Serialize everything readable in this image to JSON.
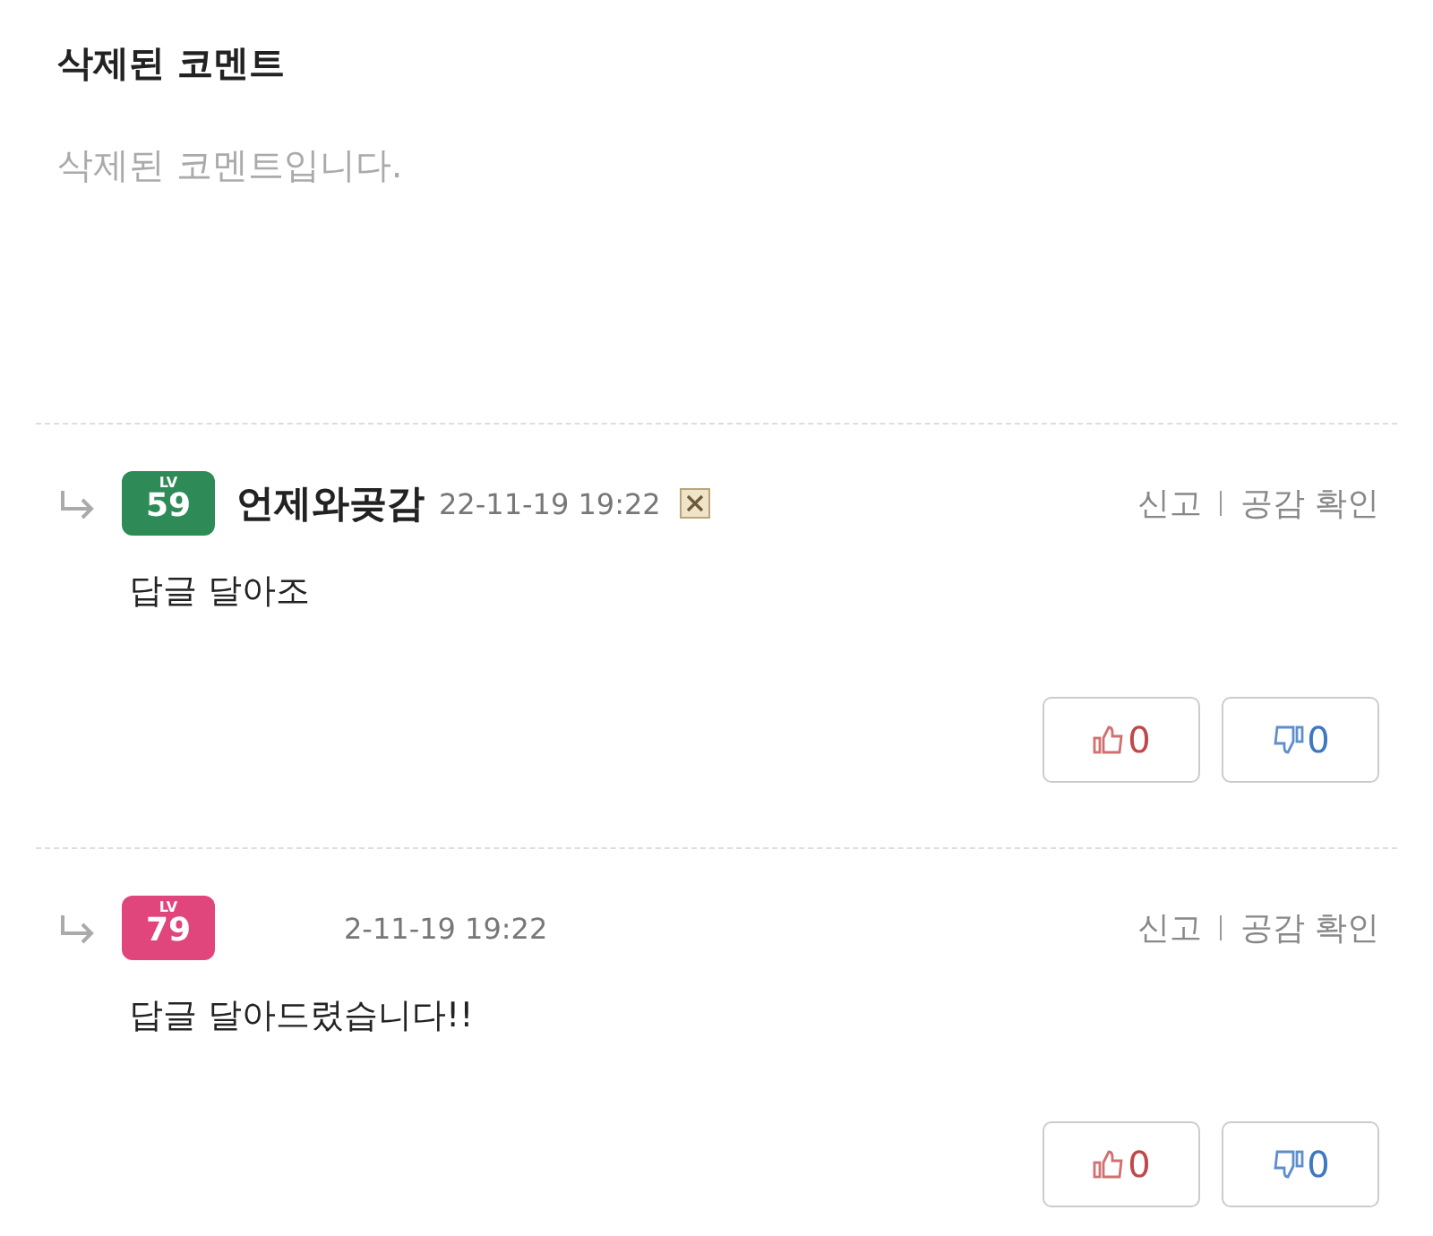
{
  "deleted_comment": {
    "title": "삭제된 코멘트",
    "message": "삭제된 코멘트입니다."
  },
  "replies": [
    {
      "badge": {
        "label": "LV",
        "level": "59",
        "color": "#2e8b57"
      },
      "nickname": "언제와곶감",
      "time": "22-11-19 19:22",
      "has_flag": true,
      "actions": [
        "신고",
        "공감 확인"
      ],
      "body": "답글 달아조",
      "likes": "0",
      "dislikes": "0"
    },
    {
      "badge": {
        "label": "LV",
        "level": "79",
        "color": "#e0457b"
      },
      "time": "2-11-19 19:22",
      "has_flag": false,
      "actions": [
        "신고",
        "공감 확인"
      ],
      "body": "답글 달아드렸습니다!!",
      "likes": "0",
      "dislikes": "0"
    }
  ]
}
